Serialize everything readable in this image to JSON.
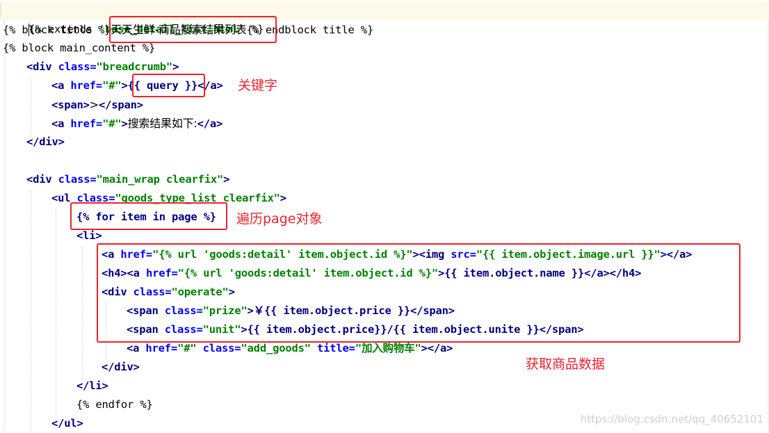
{
  "code": {
    "l1": {
      "a": "{% extends ",
      "b": "'base_detail_list.html'",
      "c": " %}"
    },
    "l2": {
      "a": "{% block title %}",
      "b": "天天生鲜-商品搜索结果列表",
      "c": "{% endblock title %}"
    },
    "l3": {
      "a": "{% block main_content %}"
    },
    "l4": {
      "a": "<div ",
      "b": "class=",
      "c": "\"breadcrumb\"",
      "d": ">"
    },
    "l5": {
      "a": "<a ",
      "b": "href=",
      "c": "\"#\"",
      "d": ">",
      "e": "{{ query }}",
      "f": "</a>"
    },
    "l6": {
      "a": "<span>",
      "b": ">",
      "c": "</span>"
    },
    "l7": {
      "a": "<a ",
      "b": "href=",
      "c": "\"#\"",
      "d": ">",
      "e": "搜索结果如下:",
      "f": "</a>"
    },
    "l8": {
      "a": "</div>"
    },
    "l9": {
      "a": "<div ",
      "b": "class=",
      "c": "\"main_wrap clearfix\"",
      "d": ">"
    },
    "l10": {
      "a": "<ul ",
      "b": "class=",
      "c": "\"goods_type_list clearfix\"",
      "d": ">"
    },
    "l11": {
      "a": "{% for item in page %}"
    },
    "l12": {
      "a": "<li>"
    },
    "l13": {
      "a": "<a ",
      "b": "href=",
      "c": "\"{% url 'goods:detail' item.object.id %}\"",
      "d": "><img ",
      "e": "src=",
      "f": "\"{{ item.object.image.url }}\"",
      "g": "></a>"
    },
    "l14": {
      "a": "<h4><a ",
      "b": "href=",
      "c": "\"{% url 'goods:detail' item.object.id %}\"",
      "d": ">",
      "e": "{{ item.object.name }}",
      "f": "</a></h4>"
    },
    "l15": {
      "a": "<div ",
      "b": "class=",
      "c": "\"operate\"",
      "d": ">"
    },
    "l16": {
      "a": "<span ",
      "b": "class=",
      "c": "\"prize\"",
      "d": ">",
      "e": "￥{{ item.object.price }}",
      "f": "</span>"
    },
    "l17": {
      "a": "<span ",
      "b": "class=",
      "c": "\"unit\"",
      "d": ">",
      "e": "{{ item.object.price}}/{{ item.object.unite }}",
      "f": "</span>"
    },
    "l18": {
      "a": "<a ",
      "b": "href=",
      "c": "\"#\"",
      "d": " class=",
      "e": "\"add_goods\"",
      "f": " title=",
      "g": "\"加入购物车\"",
      "h": "></a>"
    },
    "l19": {
      "a": "</div>"
    },
    "l20": {
      "a": "</li>"
    },
    "l21": {
      "a": "{% endfor %}"
    },
    "l22": {
      "a": "</ul>"
    }
  },
  "annotations": {
    "keyword": "关键字",
    "iterate": "遍历page对象",
    "fetch": "获取商品数据"
  },
  "watermark": "https://blog.csdn.net/qq_40652101",
  "colors": {
    "annotation": "#e8232e",
    "tag": "#000080",
    "attribute": "#0000ff",
    "string": "#008000"
  }
}
